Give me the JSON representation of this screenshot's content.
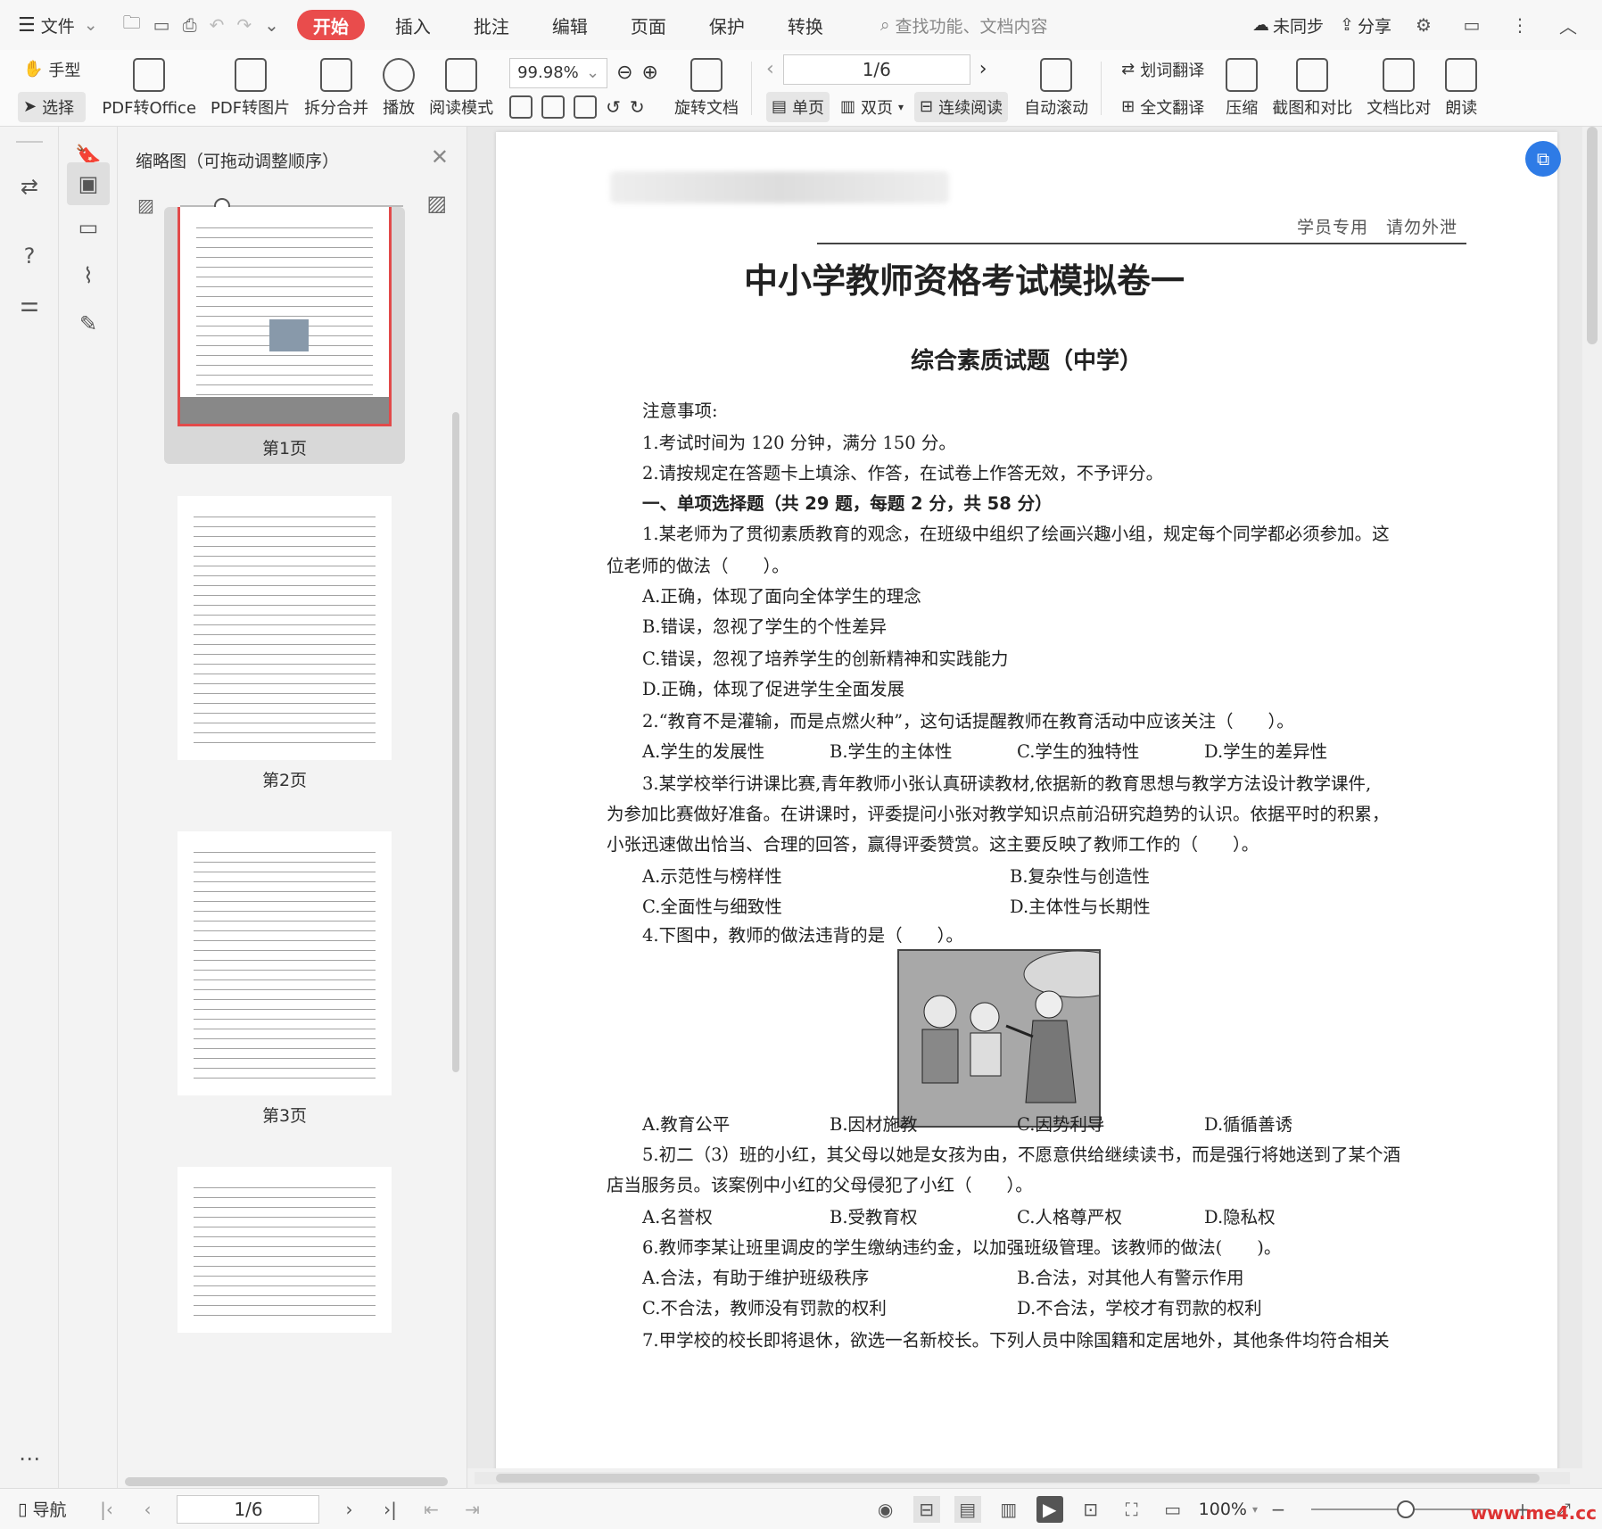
{
  "menubar": {
    "file_label": "文件",
    "tabs": [
      "开始",
      "插入",
      "批注",
      "编辑",
      "页面",
      "保护",
      "转换"
    ],
    "active_tab": "开始",
    "search_placeholder": "查找功能、文档内容",
    "sync_label": "未同步",
    "share_label": "分享"
  },
  "toolbar": {
    "hand_label": "手型",
    "select_label": "选择",
    "pdf_to_office": "PDF转Office",
    "pdf_to_image": "PDF转图片",
    "split_merge": "拆分合并",
    "play": "播放",
    "read_mode": "阅读模式",
    "zoom_value": "99.98%",
    "rotate_doc": "旋转文档",
    "page_indicator": "1/6",
    "single_page": "单页",
    "double_page": "双页",
    "continuous": "连续阅读",
    "auto_scroll": "自动滚动",
    "word_translate": "划词翻译",
    "full_translate": "全文翻译",
    "compress": "压缩",
    "screenshot_compare": "截图和对比",
    "doc_compare": "文档比对",
    "read_aloud": "朗读"
  },
  "thumbs": {
    "title": "缩略图（可拖动调整顺序）",
    "pages": [
      "第1页",
      "第2页",
      "第3页"
    ]
  },
  "document": {
    "confidential": "学员专用　请勿外泄",
    "title": "中小学教师资格考试模拟卷一",
    "subtitle": "综合素质试题（中学）",
    "notice_title": "注意事项:",
    "notice1": "1.考试时间为 120 分钟，满分 150 分。",
    "notice2": "2.请按规定在答题卡上填涂、作答，在试卷上作答无效，不予评分。",
    "section1": "一、单项选择题（共 29 题，每题 2 分，共 58 分）",
    "q1_a": "1.某老师为了贯彻素质教育的观念，在班级中组织了绘画兴趣小组，规定每个同学都必须参加。这",
    "q1_b": "位老师的做法（　　）。",
    "q1_opts": [
      "A.正确，体现了面向全体学生的理念",
      "B.错误，忽视了学生的个性差异",
      "C.错误，忽视了培养学生的创新精神和实践能力",
      "D.正确，体现了促进学生全面发展"
    ],
    "q2": "2.“教育不是灌输，而是点燃火种”，这句话提醒教师在教育活动中应该关注（　　）。",
    "q2_opts": [
      "A.学生的发展性",
      "B.学生的主体性",
      "C.学生的独特性",
      "D.学生的差异性"
    ],
    "q3_a": "3.某学校举行讲课比赛,青年教师小张认真研读教材,依据新的教育思想与教学方法设计教学课件,",
    "q3_b": "为参加比赛做好准备。在讲课时，评委提问小张对教学知识点前沿研究趋势的认识。依据平时的积累，",
    "q3_c": "小张迅速做出恰当、合理的回答，赢得评委赞赏。这主要反映了教师工作的（　　）。",
    "q3_opts": [
      "A.示范性与榜样性",
      "B.复杂性与创造性",
      "C.全面性与细致性",
      "D.主体性与长期性"
    ],
    "q4": "4.下图中，教师的做法违背的是（　　）。",
    "q4_opts": [
      "A.教育公平",
      "B.因材施教",
      "C.因势利导",
      "D.循循善诱"
    ],
    "q5_a": "5.初二（3）班的小红，其父母以她是女孩为由，不愿意供给继续读书，而是强行将她送到了某个酒",
    "q5_b": "店当服务员。该案例中小红的父母侵犯了小红（　　）。",
    "q5_opts": [
      "A.名誉权",
      "B.受教育权",
      "C.人格尊严权",
      "D.隐私权"
    ],
    "q6": "6.教师李某让班里调皮的学生缴纳违约金，以加强班级管理。该教师的做法(　　)。",
    "q6_opts": [
      "A.合法，有助于维护班级秩序",
      "B.合法，对其他人有警示作用",
      "C.不合法，教师没有罚款的权利",
      "D.不合法，学校才有罚款的权利"
    ],
    "q7": "7.甲学校的校长即将退休，欲选一名新校长。下列人员中除国籍和定居地外，其他条件均符合相关"
  },
  "statusbar": {
    "nav_label": "导航",
    "page_indicator": "1/6",
    "zoom_label": "100%"
  },
  "watermark": "www.me4.cc"
}
